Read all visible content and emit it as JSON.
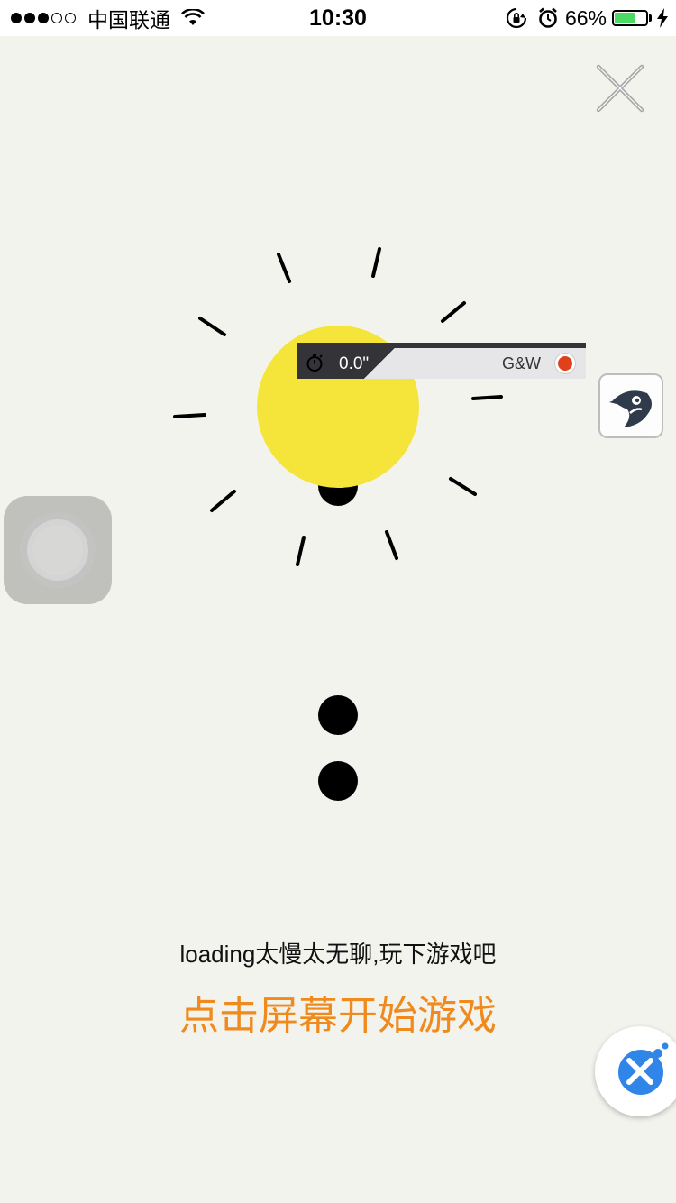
{
  "status_bar": {
    "carrier": "中国联通",
    "time": "10:30",
    "battery_percent": "66%",
    "battery_level": 0.66,
    "signal_bars_full": 3,
    "signal_bars_total": 5,
    "icons": [
      "wifi-icon",
      "rotation-lock-icon",
      "alarm-icon",
      "battery-icon",
      "charging-bolt-icon"
    ]
  },
  "game": {
    "close_icon": "close-icon",
    "sun_color": "#f5e43a",
    "hint": "loading太慢太无聊,玩下游戏吧",
    "start_label": "点击屏幕开始游戏",
    "start_color": "#f08a1c"
  },
  "recorder": {
    "time": "0.0\"",
    "label": "G&W",
    "record_color": "#e0401a",
    "icon": "stopwatch-icon"
  },
  "overlays": {
    "app_icon": "bird-app-icon",
    "assistive_touch": "assistive-touch-button",
    "float_button": "tool-float-button"
  }
}
